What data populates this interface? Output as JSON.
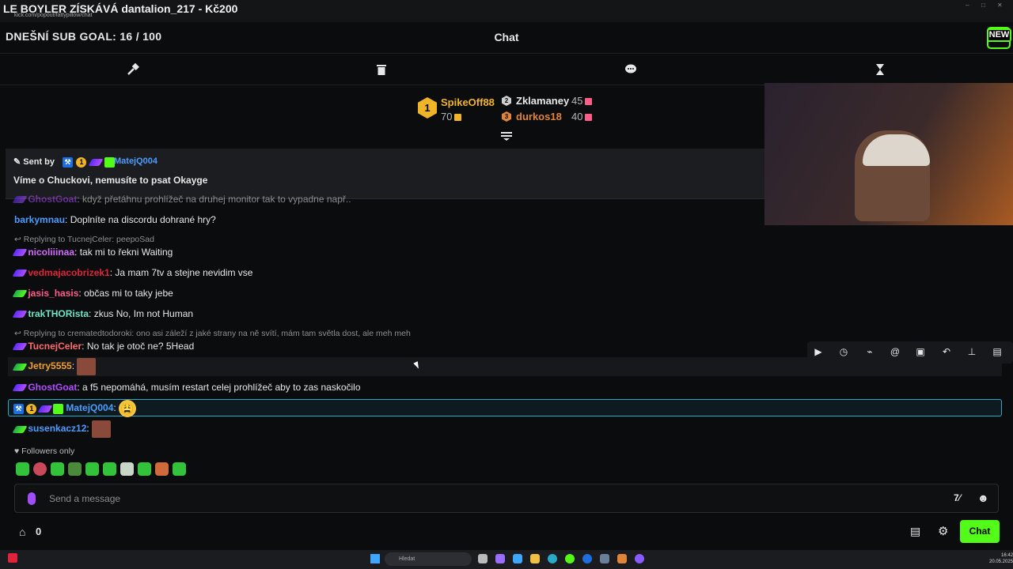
{
  "window": {
    "title": "LE BOYLER ZÍSKÁVÁ dantalion_217 - Kč200",
    "url": "kick.com/popout/fattypillow/chat"
  },
  "header": {
    "sub_goal": "DNEŠNÍ SUB GOAL: 16 / 100",
    "chat_title": "Chat",
    "more_label": "···",
    "new_label": "NEW"
  },
  "toolbar": {
    "icons": [
      "hammer-icon",
      "trash-icon",
      "chat-bubble-icon",
      "hourglass-icon"
    ]
  },
  "leaderboard": {
    "first": {
      "rank": "1",
      "name": "SpikeOff88",
      "count": "70"
    },
    "second": {
      "rank": "2",
      "name": "Zklamaney",
      "count": "45"
    },
    "third": {
      "rank": "3",
      "name": "durkos18",
      "count": "40"
    }
  },
  "pinned": {
    "sent_by": "Sent by",
    "sub_badge": "1",
    "user": "MatejQ004",
    "message": "Víme o Chuckovi, nemusíte to psat Okayge"
  },
  "messages": [
    {
      "user": "GhostGoat",
      "text": ": když přetáhnu prohlížeč na druhej monitor tak to vypadne např..",
      "color": "#b14dff"
    },
    {
      "user": "barkymnau",
      "text": ": Doplníte na discordu dohrané hry?",
      "color": "#4d9cff"
    },
    {
      "reply": "Replying to TucnejCeler: peepoSad"
    },
    {
      "user": "nicoliiinaa",
      "text": ": tak mi to řekni Waiting",
      "color": "#d46bff"
    },
    {
      "user": "vedmajacobrizek1",
      "text": ": Ja mam 7tv a stejne nevidim vse",
      "color": "#e0243c"
    },
    {
      "user": "jasis_hasis",
      "text": ": občas mi to taky jebe",
      "color": "#ff5c8a"
    },
    {
      "user": "trakTHORista",
      "text": ": zkus No, Im not Human",
      "color": "#6fe3c7"
    },
    {
      "reply": "Replying to crematedtodoroki: ono asi záleží z jaké strany na ně svítí, mám tam světla dost, ale meh meh"
    },
    {
      "user": "TucnejCeler",
      "text": ": No tak je otoč ne? 5Head",
      "color": "#ff6b6b"
    },
    {
      "user": "Jetry5555",
      "text": ":",
      "color": "#f0a030"
    },
    {
      "user": "GhostGoat",
      "text": ": a f5 nepomáhá, musím restart celej prohlížeč aby to zas naskočilo",
      "color": "#b14dff"
    },
    {
      "user": "MatejQ004",
      "text": ":",
      "color": "#4d9cff"
    },
    {
      "user": "susenkacz12",
      "text": ":",
      "color": "#4d9cff"
    }
  ],
  "footer": {
    "followers_only": "Followers only",
    "input_placeholder": "Send a message",
    "store_count": "0",
    "chat_button": "Chat"
  },
  "taskbar": {
    "search_placeholder": "Hledat",
    "time": "16:42",
    "date": "20.05.2025"
  },
  "colors": {
    "accent": "#53fc18",
    "background": "#0b0c0e",
    "pinned_bg": "#1c1d20"
  }
}
